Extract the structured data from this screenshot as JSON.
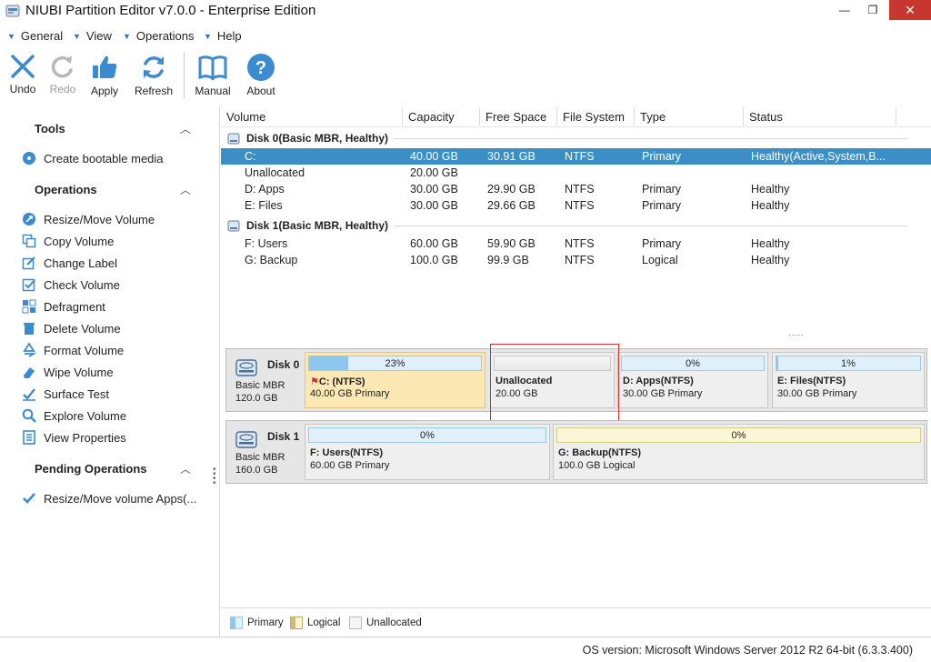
{
  "window": {
    "title": "NIUBI Partition Editor v7.0.0 - Enterprise Edition",
    "min": "—",
    "max": "❐",
    "close": "✕"
  },
  "menu": [
    "General",
    "View",
    "Operations",
    "Help"
  ],
  "toolbar": {
    "undo": "Undo",
    "redo": "Redo",
    "apply": "Apply",
    "refresh": "Refresh",
    "manual": "Manual",
    "about": "About"
  },
  "sidebar": {
    "tools_title": "Tools",
    "tools": [
      "Create bootable media"
    ],
    "operations_title": "Operations",
    "operations": [
      "Resize/Move Volume",
      "Copy Volume",
      "Change Label",
      "Check Volume",
      "Defragment",
      "Delete Volume",
      "Format Volume",
      "Wipe Volume",
      "Surface Test",
      "Explore Volume",
      "View Properties"
    ],
    "pending_title": "Pending Operations",
    "pending": [
      "Resize/Move volume Apps(..."
    ]
  },
  "table": {
    "columns": [
      "Volume",
      "Capacity",
      "Free Space",
      "File System",
      "Type",
      "Status"
    ],
    "disk0_label": "Disk 0(Basic MBR, Healthy)",
    "disk1_label": "Disk 1(Basic MBR, Healthy)",
    "disk0_rows": [
      [
        "C:",
        "40.00 GB",
        "30.91 GB",
        "NTFS",
        "Primary",
        "Healthy(Active,System,B..."
      ],
      [
        "Unallocated",
        "20.00 GB",
        "",
        "",
        "",
        ""
      ],
      [
        "D: Apps",
        "30.00 GB",
        "29.90 GB",
        "NTFS",
        "Primary",
        "Healthy"
      ],
      [
        "E: Files",
        "30.00 GB",
        "29.66 GB",
        "NTFS",
        "Primary",
        "Healthy"
      ]
    ],
    "disk1_rows": [
      [
        "F: Users",
        "60.00 GB",
        "59.90 GB",
        "NTFS",
        "Primary",
        "Healthy"
      ],
      [
        "G: Backup",
        "100.0 GB",
        "99.9 GB",
        "NTFS",
        "Logical",
        "Healthy"
      ]
    ]
  },
  "diskmap": {
    "disk0": {
      "name": "Disk 0",
      "type": "Basic MBR",
      "size": "120.0 GB",
      "parts": [
        {
          "pct": "23%",
          "used": 0.23,
          "name": "C: (NTFS)",
          "info": "40.00 GB Primary"
        },
        {
          "pct": "",
          "used": 0,
          "name": "Unallocated",
          "info": "20.00 GB"
        },
        {
          "pct": "0%",
          "used": 0,
          "name": "D: Apps(NTFS)",
          "info": "30.00 GB Primary"
        },
        {
          "pct": "1%",
          "used": 0.01,
          "name": "E: Files(NTFS)",
          "info": "30.00 GB Primary"
        }
      ]
    },
    "disk1": {
      "name": "Disk 1",
      "type": "Basic MBR",
      "size": "160.0 GB",
      "parts": [
        {
          "pct": "0%",
          "used": 0,
          "name": "F: Users(NTFS)",
          "info": "60.00 GB Primary"
        },
        {
          "pct": "0%",
          "used": 0,
          "name": "G: Backup(NTFS)",
          "info": "100.0 GB Logical"
        }
      ]
    }
  },
  "legend": {
    "primary": "Primary",
    "logical": "Logical",
    "unallocated": "Unallocated"
  },
  "status": "OS version: Microsoft Windows Server 2012 R2  64-bit  (6.3.3.400)",
  "colors": {
    "accent": "#3c8fc4",
    "primary_bar": "#8ec7ee",
    "selected_part": "#fbe8b4",
    "close": "#c7372f"
  }
}
